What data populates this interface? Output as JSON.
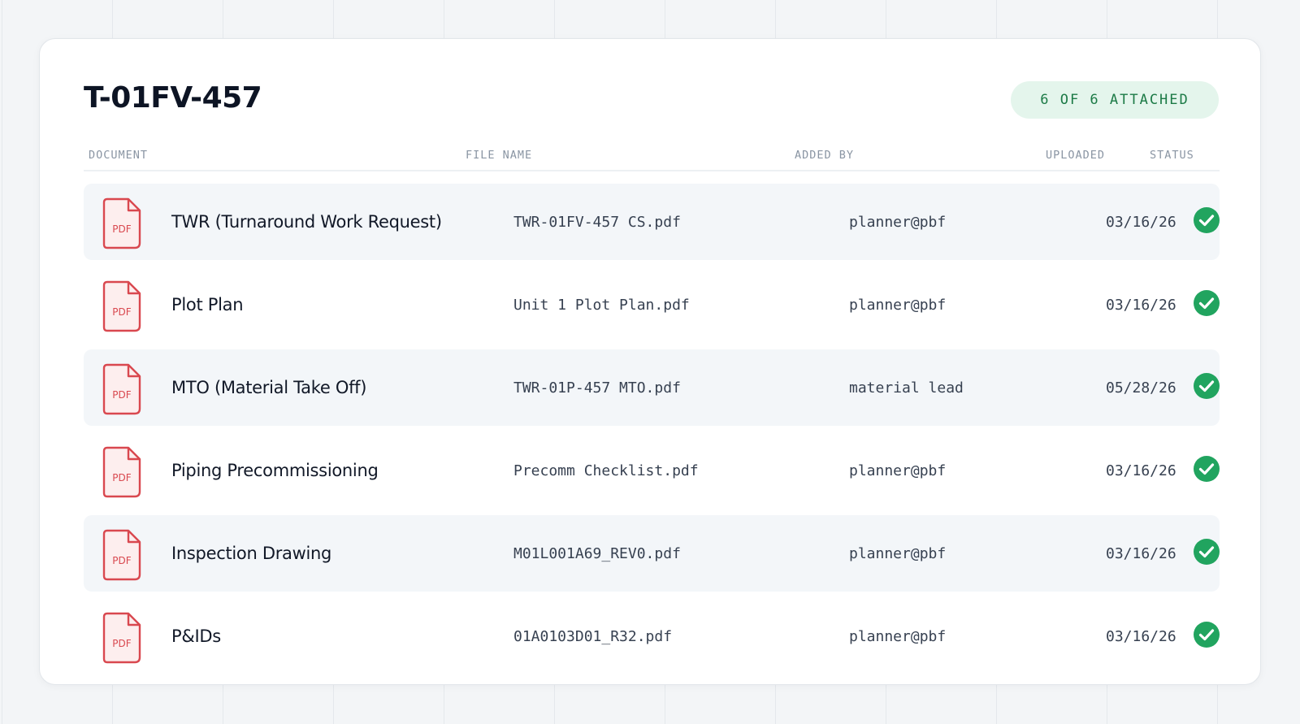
{
  "header": {
    "title": "T-01FV-457",
    "badge": "6 OF 6 ATTACHED"
  },
  "columns": {
    "document": "DOCUMENT",
    "file_name": "FILE NAME",
    "added_by": "ADDED BY",
    "uploaded": "UPLOADED",
    "status": "STATUS"
  },
  "icon_label": "PDF",
  "rows": [
    {
      "document": "TWR (Turnaround Work Request)",
      "file_name": "TWR-01FV-457 CS.pdf",
      "added_by": "planner@pbf",
      "uploaded": "03/16/26",
      "status": "check-circle-icon"
    },
    {
      "document": "Plot Plan",
      "file_name": "Unit 1 Plot Plan.pdf",
      "added_by": "planner@pbf",
      "uploaded": "03/16/26",
      "status": "check-circle-icon"
    },
    {
      "document": "MTO (Material Take Off)",
      "file_name": "TWR-01P-457 MTO.pdf",
      "added_by": "material lead",
      "uploaded": "05/28/26",
      "status": "check-circle-icon"
    },
    {
      "document": "Piping Precommissioning",
      "file_name": "Precomm Checklist.pdf",
      "added_by": "planner@pbf",
      "uploaded": "03/16/26",
      "status": "check-circle-icon"
    },
    {
      "document": "Inspection Drawing",
      "file_name": "M01L001A69_REV0.pdf",
      "added_by": "planner@pbf",
      "uploaded": "03/16/26",
      "status": "check-circle-icon"
    },
    {
      "document": "P&IDs",
      "file_name": "01A0103D01_R32.pdf",
      "added_by": "planner@pbf",
      "uploaded": "03/16/26",
      "status": "check-circle-icon"
    }
  ],
  "colors": {
    "pdf_red": "#d9484f",
    "pdf_fill": "#fdeeee",
    "success_green": "#21a45f",
    "badge_bg": "#e4f5ec",
    "badge_text": "#1c7a46"
  }
}
